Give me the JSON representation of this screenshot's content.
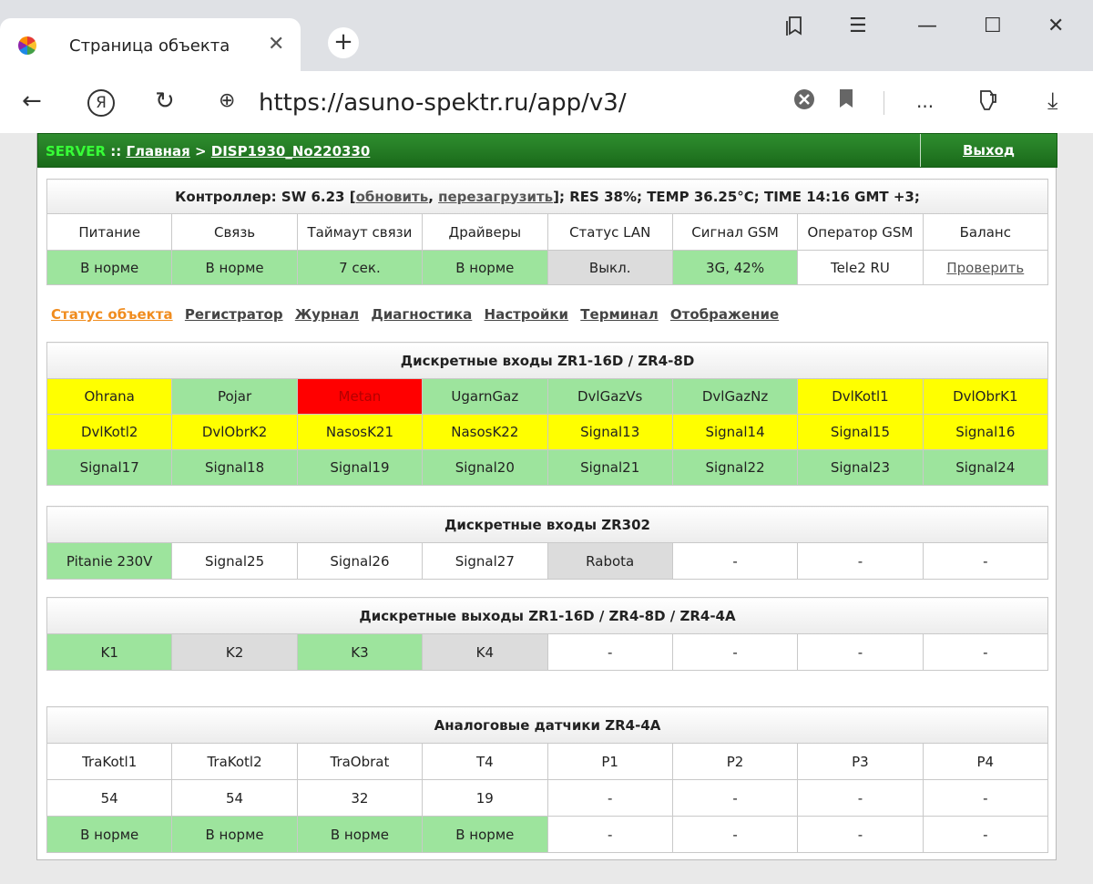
{
  "browser": {
    "tab_title": "Страница объекта",
    "url": "https://asuno-spektr.ru/app/v3/",
    "menu_dots": "..."
  },
  "topbar": {
    "server": "SERVER",
    "sep": " :: ",
    "home": "Главная",
    "arrow": " > ",
    "device": "DISP1930_No220330",
    "logout": "Выход"
  },
  "controller": {
    "prefix": "Контроллер: SW 6.23 [",
    "update": "обновить",
    "comma": ", ",
    "reboot": "перезагрузить",
    "suffix": "]; RES 38%; TEMP 36.25°C; TIME 14:16 GMT +3;",
    "headers": [
      "Питание",
      "Связь",
      "Таймаут связи",
      "Драйверы",
      "Статус LAN",
      "Сигнал GSM",
      "Оператор GSM",
      "Баланс"
    ],
    "values": [
      "В норме",
      "В норме",
      "7 сек.",
      "В норме",
      "Выкл.",
      "3G, 42%",
      "Tele2 RU",
      "Проверить"
    ]
  },
  "nav": [
    "Статус объекта",
    "Регистратор",
    "Журнал",
    "Диагностика",
    "Настройки",
    "Терминал",
    "Отображение"
  ],
  "inputs_zr1": {
    "title": "Дискретные входы ZR1-16D / ZR4-8D",
    "rows": [
      [
        "Ohrana",
        "Pojar",
        "Metan",
        "UgarnGaz",
        "DvlGazVs",
        "DvlGazNz",
        "DvlKotl1",
        "DvlObrK1"
      ],
      [
        "DvlKotl2",
        "DvlObrK2",
        "NasosK21",
        "NasosK22",
        "Signal13",
        "Signal14",
        "Signal15",
        "Signal16"
      ],
      [
        "Signal17",
        "Signal18",
        "Signal19",
        "Signal20",
        "Signal21",
        "Signal22",
        "Signal23",
        "Signal24"
      ]
    ]
  },
  "inputs_zr302": {
    "title": "Дискретные входы ZR302",
    "row": [
      "Pitanie 230V",
      "Signal25",
      "Signal26",
      "Signal27",
      "Rabota",
      "-",
      "-",
      "-"
    ]
  },
  "outputs": {
    "title": "Дискретные выходы ZR1-16D / ZR4-8D / ZR4-4A",
    "row": [
      "K1",
      "K2",
      "K3",
      "K4",
      "-",
      "-",
      "-",
      "-"
    ]
  },
  "analog": {
    "title": "Аналоговые датчики ZR4-4A",
    "names": [
      "TraKotl1",
      "TraKotl2",
      "TraObrat",
      "T4",
      "P1",
      "P2",
      "P3",
      "P4"
    ],
    "values": [
      "54",
      "54",
      "32",
      "19",
      "-",
      "-",
      "-",
      "-"
    ],
    "status": [
      "В норме",
      "В норме",
      "В норме",
      "В норме",
      "-",
      "-",
      "-",
      "-"
    ]
  },
  "colors": {
    "ok_green": "#9de49d",
    "warn_yellow": "#ffff00",
    "alarm_red": "#ff0000",
    "off_gray": "#dcdcdc",
    "topbar_green": "#1a6a1a",
    "active_tab": "#f08c1e"
  }
}
